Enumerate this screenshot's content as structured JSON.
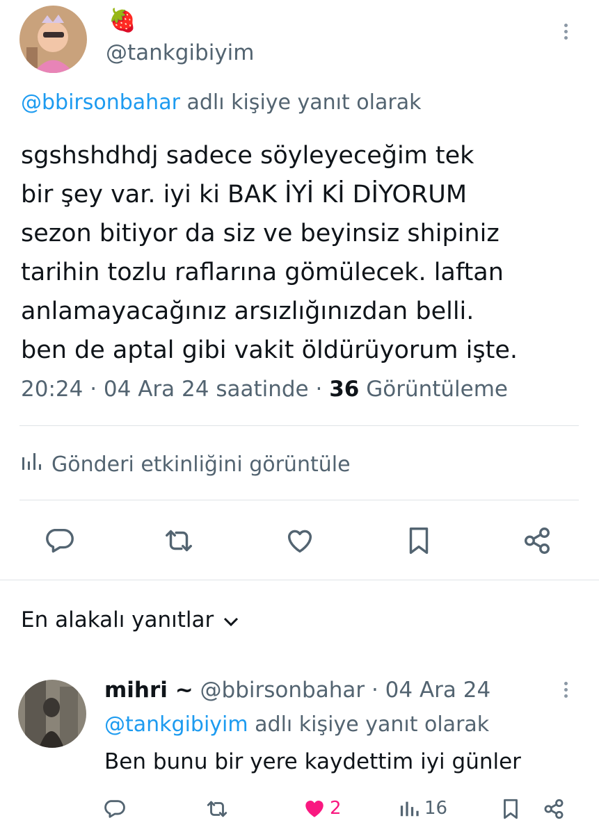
{
  "post": {
    "display_name": "🍓",
    "handle": "@tankgibiyim",
    "reply_to_handle": "@bbirsonbahar",
    "reply_to_suffix": "adlı kişiye yanıt olarak",
    "body_lines": [
      "sgshshdhdj sadece söyleyeceğim tek",
      "bir şey var. iyi ki BAK İYİ Kİ DİYORUM",
      "sezon bitiyor da siz ve beyinsiz shipiniz",
      "tarihin tozlu raflarına gömülecek. laftan",
      "anlamayacağınız arsızlığınızdan belli.",
      "ben de aptal gibi vakit öldürüyorum işte."
    ],
    "time": "20:24",
    "sep": "·",
    "date_text": "04 Ara 24 saatinde",
    "views_count": "36",
    "views_label": "Görüntüleme",
    "activity_label": "Gönderi etkinliğini görüntüle"
  },
  "actions": [
    "reply-icon",
    "retweet-icon",
    "like-icon",
    "bookmark-icon",
    "share-icon"
  ],
  "replies_section": {
    "sort_label": "En alakalı yanıtlar"
  },
  "reply": {
    "name": "mihri ~",
    "handle": "@bbirsonbahar",
    "sep": "·",
    "date": "04 Ara 24",
    "reply_to_handle": "@tankgibiyim",
    "reply_to_suffix": "adlı kişiye yanıt olarak",
    "text": "Ben bunu bir yere kaydettim iyi günler",
    "likes": "2",
    "views": "16"
  },
  "colors": {
    "link": "#1d9bf0",
    "muted": "#536471",
    "like_active": "#f91880",
    "icon": "#536471"
  }
}
